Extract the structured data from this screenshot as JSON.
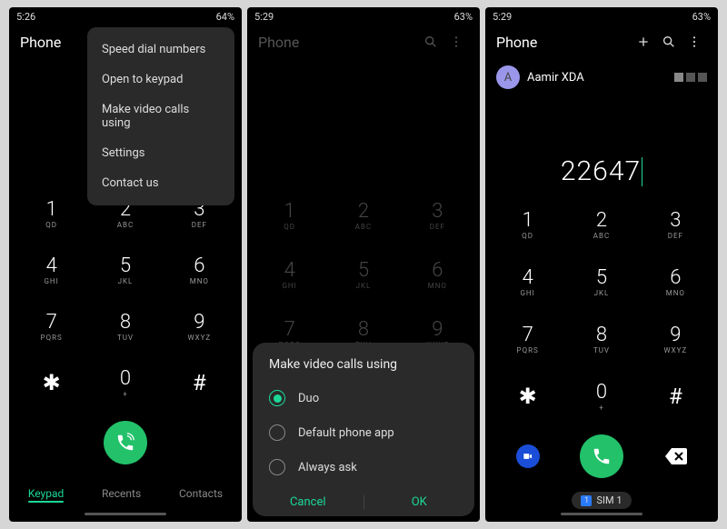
{
  "screens": [
    {
      "time": "5:26",
      "battery": "64%",
      "title": "Phone"
    },
    {
      "time": "5:29",
      "battery": "63%",
      "title": "Phone"
    },
    {
      "time": "5:29",
      "battery": "63%",
      "title": "Phone"
    }
  ],
  "menu": {
    "items": [
      "Speed dial numbers",
      "Open to keypad",
      "Make video calls using",
      "Settings",
      "Contact us"
    ]
  },
  "dialog": {
    "title": "Make video calls using",
    "options": [
      "Duo",
      "Default phone app",
      "Always ask"
    ],
    "cancel": "Cancel",
    "ok": "OK"
  },
  "tabs": {
    "keypad": "Keypad",
    "recents": "Recents",
    "contacts": "Contacts"
  },
  "keypad": [
    {
      "n": "1",
      "s": "QD"
    },
    {
      "n": "2",
      "s": "ABC"
    },
    {
      "n": "3",
      "s": "DEF"
    },
    {
      "n": "4",
      "s": "GHI"
    },
    {
      "n": "5",
      "s": "JKL"
    },
    {
      "n": "6",
      "s": "MNO"
    },
    {
      "n": "7",
      "s": "PQRS"
    },
    {
      "n": "8",
      "s": "TUV"
    },
    {
      "n": "9",
      "s": "WXYZ"
    },
    {
      "n": "*",
      "s": ""
    },
    {
      "n": "0",
      "s": "+"
    },
    {
      "n": "#",
      "s": ""
    }
  ],
  "screen3": {
    "dialed": "22647",
    "suggest_name": "Aamir XDA",
    "suggest_initial": "A",
    "sim_label": "SIM 1",
    "sim_num": "1"
  }
}
